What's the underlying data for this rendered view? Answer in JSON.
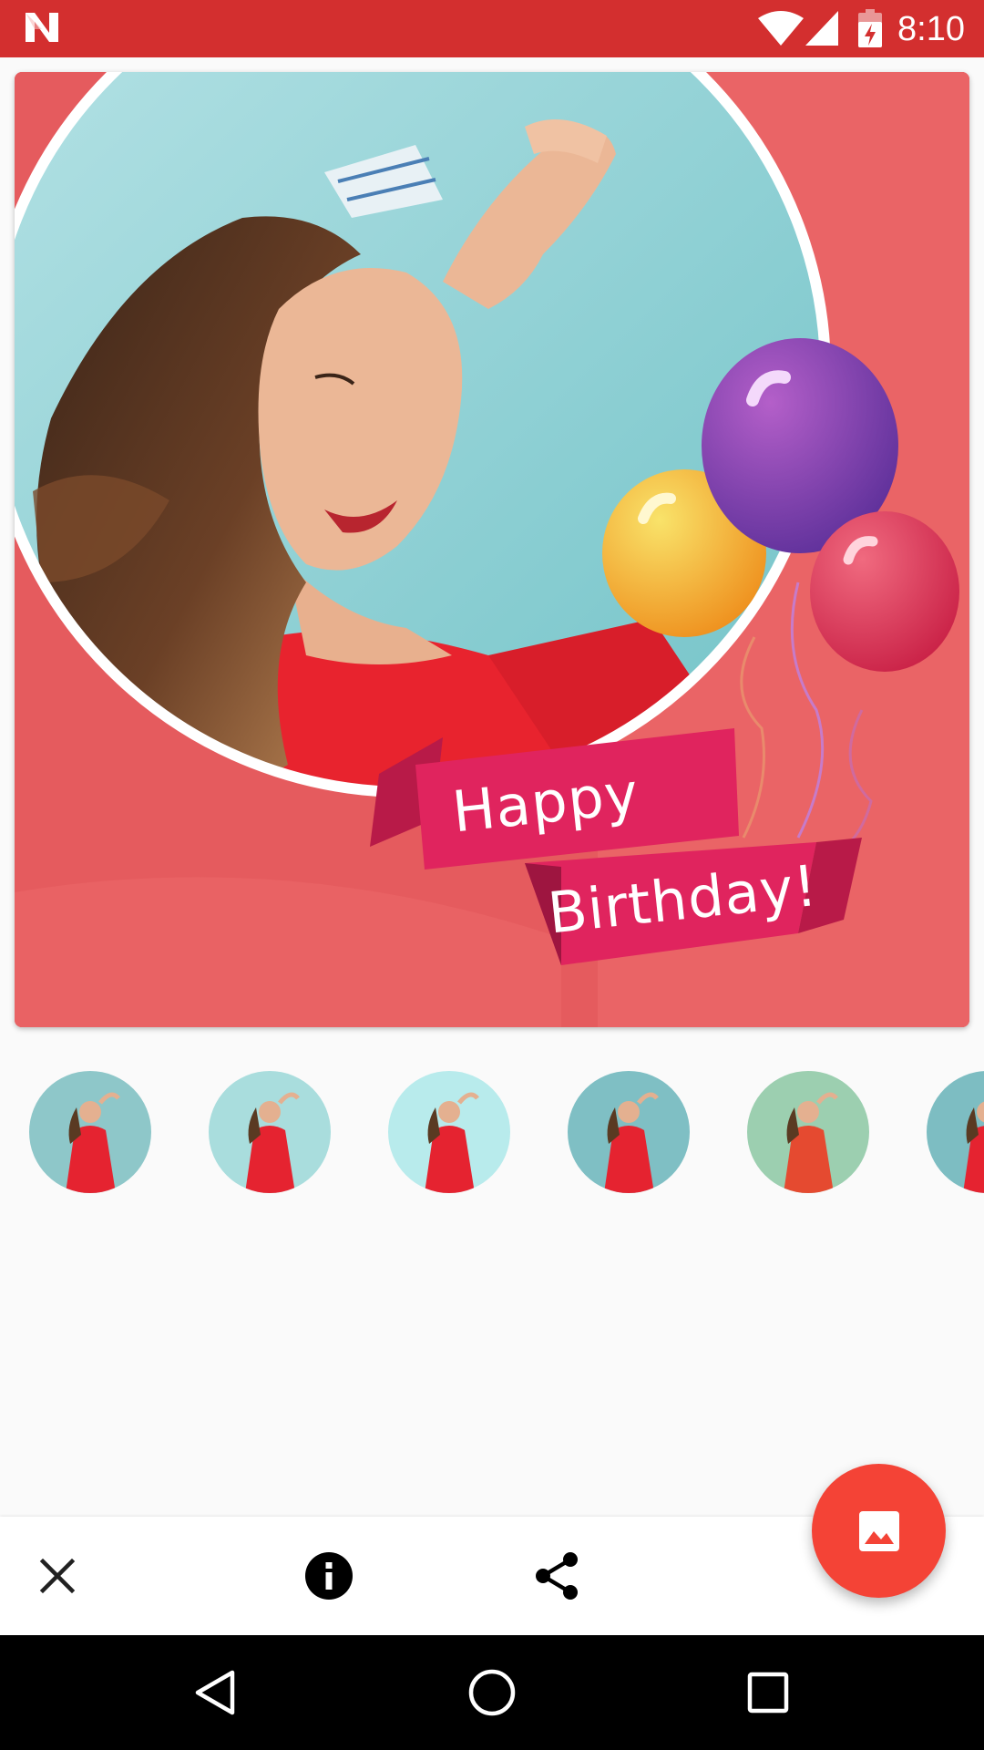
{
  "status_bar": {
    "time": "8:10",
    "icons": [
      "n-logo-icon",
      "wifi-icon",
      "signal-icon",
      "battery-charging-icon"
    ],
    "background": "#D32F2F"
  },
  "frame": {
    "greeting_line1": "Happy",
    "greeting_line2": "Birthday!",
    "colors": {
      "frame_red": "#E85A5A",
      "ribbon": "#E0245E",
      "balloon_purple": "#8E3FA8",
      "balloon_yellow": "#F5B321",
      "balloon_red": "#E8354E",
      "sky": "#9FD9DC"
    }
  },
  "thumbnails": {
    "count_visible": 6,
    "items": [
      "thumbnail-1",
      "thumbnail-2",
      "thumbnail-3",
      "thumbnail-4",
      "thumbnail-5",
      "thumbnail-6"
    ]
  },
  "action_bar": {
    "icons": [
      "close-icon",
      "info-icon",
      "share-icon"
    ]
  },
  "fab": {
    "icon": "image-icon",
    "color": "#F44336"
  },
  "nav_bar": {
    "icons": [
      "back-icon",
      "home-icon",
      "recents-icon"
    ]
  }
}
